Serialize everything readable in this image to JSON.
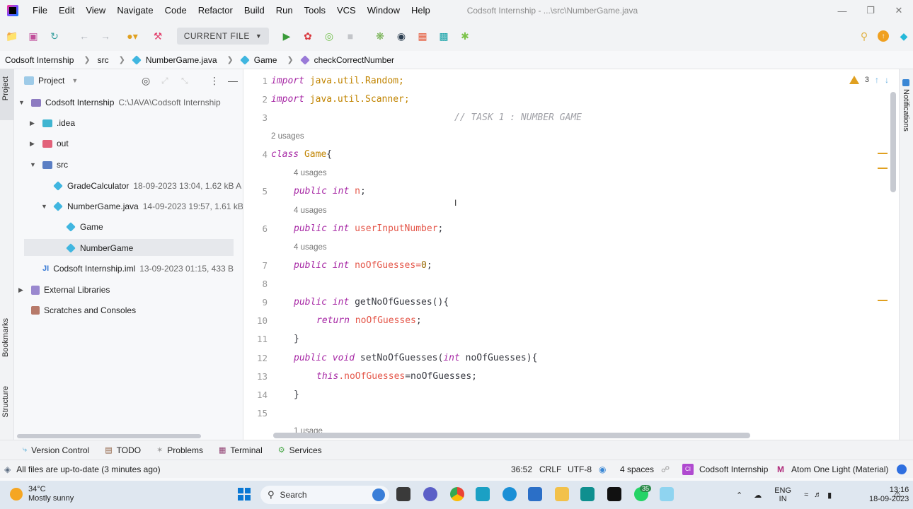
{
  "window": {
    "title": "Codsoft Internship - ...\\src\\NumberGame.java",
    "minimize": "—",
    "restore": "❐",
    "close": "✕"
  },
  "menu": [
    "File",
    "Edit",
    "View",
    "Navigate",
    "Code",
    "Refactor",
    "Build",
    "Run",
    "Tools",
    "VCS",
    "Window",
    "Help"
  ],
  "toolbar": {
    "run_config": "CURRENT FILE"
  },
  "breadcrumb": {
    "project": "Codsoft Internship",
    "src": "src",
    "file": "NumberGame.java",
    "class": "Game",
    "method": "checkCorrectNumber"
  },
  "left_stripe": {
    "project_tab": "Project",
    "bookmarks_tab": "Bookmarks",
    "structure_tab": "Structure"
  },
  "right_stripe": {
    "notifications_tab": "Notifications"
  },
  "project_panel": {
    "title": "Project",
    "tree": {
      "root": {
        "name": "Codsoft Internship",
        "meta": "C:\\JAVA\\Codsoft Internship"
      },
      "idea": {
        "name": ".idea"
      },
      "out": {
        "name": "out"
      },
      "src": {
        "name": "src"
      },
      "grade": {
        "name": "GradeCalculator",
        "meta": "18-09-2023 13:04, 1.62 kB A mir"
      },
      "numbergame_file": {
        "name": "NumberGame.java",
        "meta": "14-09-2023 19:57, 1.61 kB A r"
      },
      "game_class": {
        "name": "Game"
      },
      "numbergame_class": {
        "name": "NumberGame"
      },
      "iml": {
        "name": "Codsoft Internship.iml",
        "meta": "13-09-2023 01:15, 433 B"
      },
      "ext_libs": {
        "name": "External Libraries"
      },
      "scratches": {
        "name": "Scratches and Consoles"
      }
    }
  },
  "editor": {
    "warnings": "3",
    "hints": {
      "h1": "2 usages",
      "h2": "4 usages",
      "h3": "4 usages",
      "h4": "4 usages",
      "h5": "1 usage"
    },
    "lines": {
      "l1": {
        "num": "1",
        "kw": "import",
        "rest": " java.util.Random;"
      },
      "l2": {
        "num": "2",
        "kw": "import",
        "rest": " java.util.Scanner;"
      },
      "l3": {
        "num": "3",
        "comment": "// TASK 1 : NUMBER GAME"
      },
      "l4": {
        "num": "4",
        "kw": "class",
        "cls": " Game",
        "rest": "{"
      },
      "l5": {
        "num": "5",
        "kw": "public",
        "ty": " int",
        "fld": " n",
        "rest": ";"
      },
      "l6": {
        "num": "6",
        "kw": "public",
        "ty": " int",
        "fld": " userInputNumber",
        "rest": ";"
      },
      "l7": {
        "num": "7",
        "kw": "public",
        "ty": " int",
        "fld": " noOfGuesses",
        "op": "=",
        "val": "0",
        "rest": ";"
      },
      "l8": {
        "num": "8"
      },
      "l9": {
        "num": "9",
        "kw": "public",
        "ty": " int",
        "rest": " getNoOfGuesses(){"
      },
      "l10": {
        "num": "10",
        "kw": "return",
        "fld": " noOfGuesses",
        "rest": ";"
      },
      "l11": {
        "num": "11",
        "rest": "}"
      },
      "l12": {
        "num": "12",
        "kw": "public",
        "ty": " void",
        "rest": " setNoOfGuesses(",
        "param_ty": "int",
        "param": " noOfGuesses){"
      },
      "l13": {
        "num": "13",
        "kw": "this",
        "fld": ".noOfGuesses",
        "rest": "=noOfGuesses;"
      },
      "l14": {
        "num": "14",
        "rest": "}"
      },
      "l15": {
        "num": "15"
      }
    }
  },
  "tool_tabs": [
    "Version Control",
    "TODO",
    "Problems",
    "Terminal",
    "Services"
  ],
  "status": {
    "message": "All files are up-to-date (3 minutes ago)",
    "position": "36:52",
    "line_sep": "CRLF",
    "encoding": "UTF-8",
    "indent": "4 spaces",
    "project": "Codsoft Internship",
    "theme": "Atom One Light (Material)"
  },
  "taskbar": {
    "temp": "34°C",
    "weather": "Mostly sunny",
    "search": "Search",
    "badge": "35",
    "lang_top": "ENG",
    "lang_bottom": "IN",
    "time": "13:16",
    "date": "18-09-2023"
  }
}
